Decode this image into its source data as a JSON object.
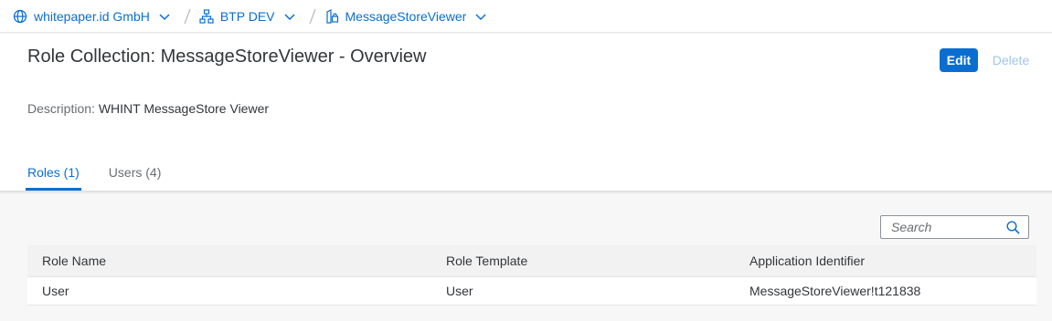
{
  "breadcrumbs": [
    {
      "label": "whitepaper.id GmbH",
      "icon": "globe-icon"
    },
    {
      "label": "BTP DEV",
      "icon": "hierarchy-icon"
    },
    {
      "label": "MessageStoreViewer",
      "icon": "role-lock-icon"
    }
  ],
  "page": {
    "title": "Role Collection: MessageStoreViewer - Overview",
    "edit_label": "Edit",
    "delete_label": "Delete",
    "description_label": "Description:",
    "description_value": "WHINT MessageStore Viewer"
  },
  "tabs": [
    {
      "label": "Roles (1)",
      "active": true
    },
    {
      "label": "Users (4)",
      "active": false
    }
  ],
  "search": {
    "placeholder": "Search",
    "value": ""
  },
  "table": {
    "columns": [
      "Role Name",
      "Role Template",
      "Application Identifier"
    ],
    "rows": [
      [
        "User",
        "User",
        "MessageStoreViewer!t121838"
      ]
    ]
  },
  "colors": {
    "accent": "#0a6ed1",
    "text": "#32363a",
    "muted": "#6a6d70",
    "disabled": "#9fc4e9"
  }
}
